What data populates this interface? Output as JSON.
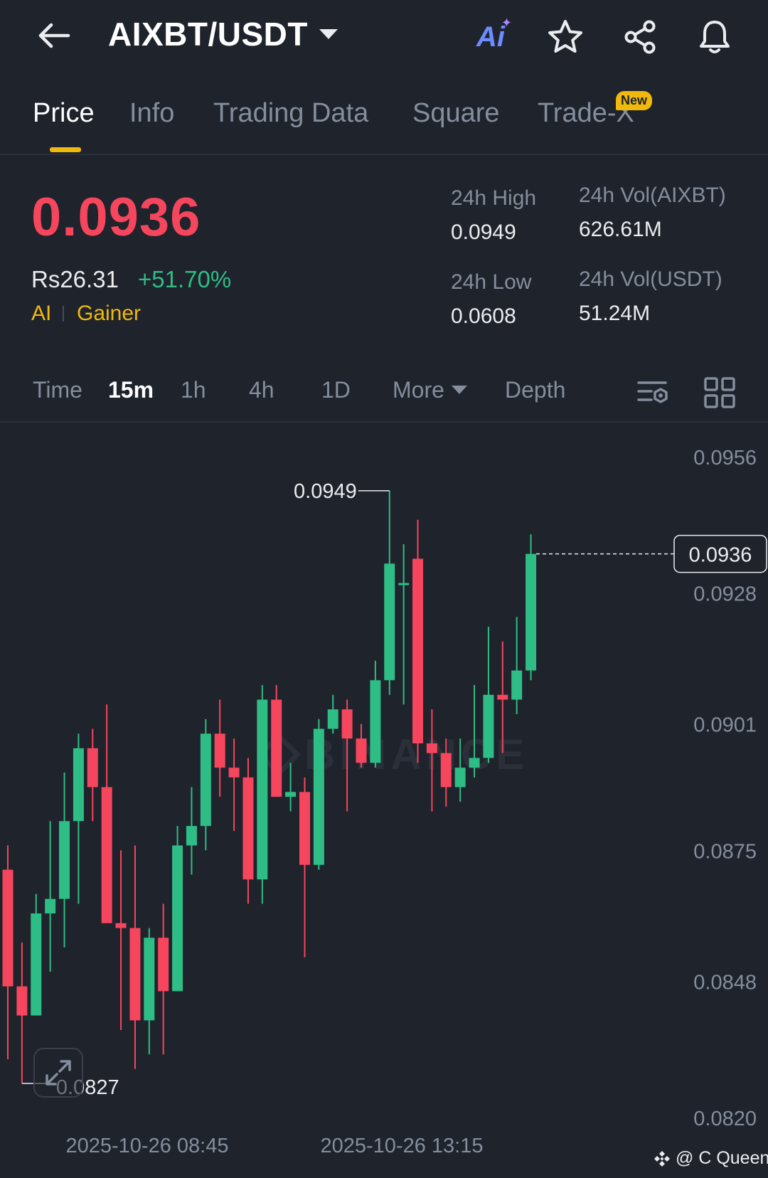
{
  "header": {
    "pair": "AIXBT/USDT",
    "icons": [
      "back-arrow-icon",
      "ai-icon",
      "star-icon",
      "share-icon",
      "bell-icon"
    ],
    "ai_label": "Ai"
  },
  "tabs": [
    {
      "label": "Price",
      "active": true
    },
    {
      "label": "Info"
    },
    {
      "label": "Trading Data"
    },
    {
      "label": "Square"
    },
    {
      "label": "Trade-X",
      "badge": "New"
    }
  ],
  "price": {
    "last": "0.0936",
    "fiat": "Rs26.31",
    "change": "+51.70%",
    "tags": [
      "AI",
      "Gainer"
    ]
  },
  "stats": {
    "high_label": "24h High",
    "high": "0.0949",
    "low_label": "24h Low",
    "low": "0.0608",
    "vol_base_label": "24h Vol(AIXBT)",
    "vol_base": "626.61M",
    "vol_quote_label": "24h Vol(USDT)",
    "vol_quote": "51.24M"
  },
  "intervals": {
    "time": "Time",
    "options": [
      "15m",
      "1h",
      "4h",
      "1D"
    ],
    "active": "15m",
    "more": "More",
    "depth": "Depth"
  },
  "chart_data": {
    "type": "candlestick",
    "interval": "15m",
    "ylim": [
      0.082,
      0.0956
    ],
    "y_ticks": [
      "0.0956",
      "0.0928",
      "0.0901",
      "0.0875",
      "0.0848",
      "0.0820"
    ],
    "x_ticks": [
      "2025-10-26 08:45",
      "2025-10-26 13:15"
    ],
    "high_marker": "0.0949",
    "low_marker": "0.0827",
    "last_price_label": "0.0936",
    "colors": {
      "up": "#2ebd85",
      "down": "#f6465d"
    },
    "candles": [
      {
        "o": 0.0871,
        "h": 0.0876,
        "l": 0.0832,
        "c": 0.0847
      },
      {
        "o": 0.0847,
        "h": 0.0856,
        "l": 0.0827,
        "c": 0.0841
      },
      {
        "o": 0.0841,
        "h": 0.0866,
        "l": 0.0841,
        "c": 0.0862
      },
      {
        "o": 0.0862,
        "h": 0.0881,
        "l": 0.085,
        "c": 0.0865
      },
      {
        "o": 0.0865,
        "h": 0.0891,
        "l": 0.0855,
        "c": 0.0881
      },
      {
        "o": 0.0881,
        "h": 0.0899,
        "l": 0.0864,
        "c": 0.0896
      },
      {
        "o": 0.0896,
        "h": 0.09,
        "l": 0.0881,
        "c": 0.0888
      },
      {
        "o": 0.0888,
        "h": 0.0905,
        "l": 0.0865,
        "c": 0.086
      },
      {
        "o": 0.086,
        "h": 0.0875,
        "l": 0.0838,
        "c": 0.0859
      },
      {
        "o": 0.0859,
        "h": 0.0876,
        "l": 0.083,
        "c": 0.084
      },
      {
        "o": 0.084,
        "h": 0.0859,
        "l": 0.0833,
        "c": 0.0857
      },
      {
        "o": 0.0857,
        "h": 0.0864,
        "l": 0.0833,
        "c": 0.0846
      },
      {
        "o": 0.0846,
        "h": 0.088,
        "l": 0.0846,
        "c": 0.0876
      },
      {
        "o": 0.0876,
        "h": 0.0888,
        "l": 0.087,
        "c": 0.088
      },
      {
        "o": 0.088,
        "h": 0.0902,
        "l": 0.0875,
        "c": 0.0899
      },
      {
        "o": 0.0899,
        "h": 0.0906,
        "l": 0.0886,
        "c": 0.0892
      },
      {
        "o": 0.0892,
        "h": 0.0898,
        "l": 0.0879,
        "c": 0.089
      },
      {
        "o": 0.089,
        "h": 0.0894,
        "l": 0.0864,
        "c": 0.0869
      },
      {
        "o": 0.0869,
        "h": 0.0909,
        "l": 0.0864,
        "c": 0.0906
      },
      {
        "o": 0.0906,
        "h": 0.0909,
        "l": 0.0886,
        "c": 0.0886
      },
      {
        "o": 0.0886,
        "h": 0.0893,
        "l": 0.0883,
        "c": 0.0887
      },
      {
        "o": 0.0887,
        "h": 0.089,
        "l": 0.0853,
        "c": 0.0872
      },
      {
        "o": 0.0872,
        "h": 0.0902,
        "l": 0.0871,
        "c": 0.09
      },
      {
        "o": 0.09,
        "h": 0.0907,
        "l": 0.0899,
        "c": 0.0904
      },
      {
        "o": 0.0904,
        "h": 0.0906,
        "l": 0.0883,
        "c": 0.0898
      },
      {
        "o": 0.0898,
        "h": 0.0901,
        "l": 0.0892,
        "c": 0.0893
      },
      {
        "o": 0.0893,
        "h": 0.0914,
        "l": 0.0892,
        "c": 0.091
      },
      {
        "o": 0.091,
        "h": 0.0949,
        "l": 0.0907,
        "c": 0.0934
      },
      {
        "o": 0.093,
        "h": 0.0938,
        "l": 0.0905,
        "c": 0.093
      },
      {
        "o": 0.0935,
        "h": 0.0943,
        "l": 0.0893,
        "c": 0.0897
      },
      {
        "o": 0.0897,
        "h": 0.0904,
        "l": 0.0883,
        "c": 0.0895
      },
      {
        "o": 0.0895,
        "h": 0.0898,
        "l": 0.0884,
        "c": 0.0888
      },
      {
        "o": 0.0888,
        "h": 0.0898,
        "l": 0.0885,
        "c": 0.0892
      },
      {
        "o": 0.0892,
        "h": 0.0909,
        "l": 0.089,
        "c": 0.0894
      },
      {
        "o": 0.0894,
        "h": 0.0921,
        "l": 0.0893,
        "c": 0.0907
      },
      {
        "o": 0.0907,
        "h": 0.0918,
        "l": 0.0895,
        "c": 0.0906
      },
      {
        "o": 0.0906,
        "h": 0.0923,
        "l": 0.0903,
        "c": 0.0912
      },
      {
        "o": 0.0912,
        "h": 0.094,
        "l": 0.091,
        "c": 0.0936
      }
    ]
  },
  "credit": "@ C Queen"
}
